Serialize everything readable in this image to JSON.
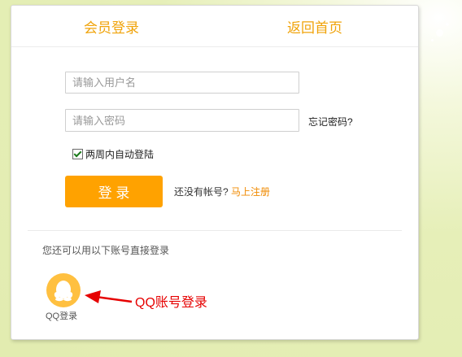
{
  "tabs": {
    "login": "会员登录",
    "home": "返回首页"
  },
  "form": {
    "username_placeholder": "请输入用户名",
    "username_value": "",
    "password_placeholder": "请输入密码",
    "password_value": "",
    "forgot_password": "忘记密码?",
    "remember_label": "两周内自动登陆",
    "remember_checked": true,
    "login_button": "登 录",
    "no_account": "还没有帐号?",
    "register_link": "马上注册"
  },
  "alt": {
    "prompt": "您还可以用以下账号直接登录",
    "qq_label": "QQ登录",
    "qq_icon": "qq-penguin-icon"
  },
  "annotation": {
    "text": "QQ账号登录",
    "color": "#e60000"
  },
  "colors": {
    "accent": "#ffa200",
    "tab_text": "#f0a30a",
    "link": "#f08a00",
    "qq": "#ffc040"
  }
}
